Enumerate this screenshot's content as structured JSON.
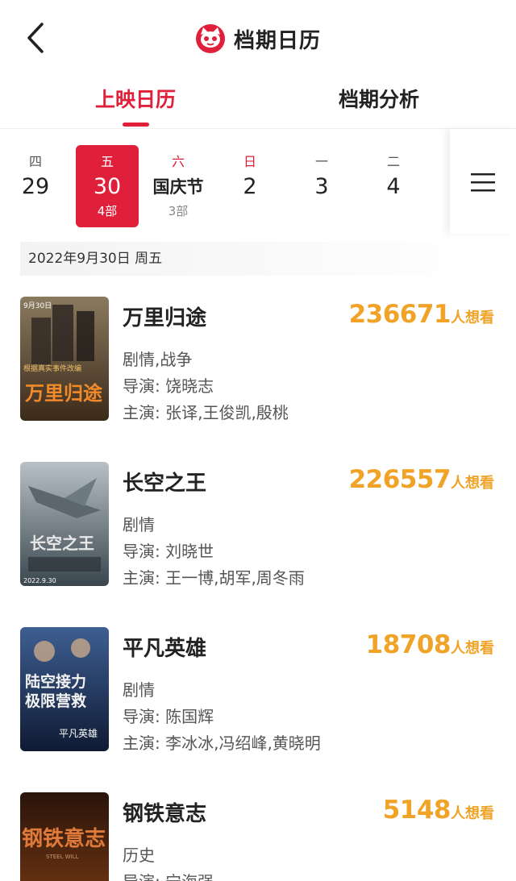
{
  "header": {
    "title": "档期日历"
  },
  "tabs": [
    {
      "label": "上映日历",
      "active": true
    },
    {
      "label": "档期分析",
      "active": false
    }
  ],
  "dates": [
    {
      "weekday": "四",
      "day": "29",
      "count": "",
      "active": false,
      "weekend": false
    },
    {
      "weekday": "五",
      "day": "30",
      "count": "4部",
      "active": true,
      "weekend": false
    },
    {
      "weekday": "六",
      "day": "国庆节",
      "count": "3部",
      "active": false,
      "weekend": true
    },
    {
      "weekday": "日",
      "day": "2",
      "count": "",
      "active": false,
      "weekend": true
    },
    {
      "weekday": "一",
      "day": "3",
      "count": "",
      "active": false,
      "weekend": false
    },
    {
      "weekday": "二",
      "day": "4",
      "count": "",
      "active": false,
      "weekend": false
    }
  ],
  "date_banner": "2022年9月30日  周五",
  "movies": [
    {
      "title": "万里归途",
      "want": "236671",
      "want_label": "人想看",
      "genre": "剧情,战争",
      "director": "导演:  饶晓志",
      "cast": "主演:  张译,王俊凯,殷桃",
      "poster_colors": [
        "#6b5a3e",
        "#b68a4a"
      ]
    },
    {
      "title": "长空之王",
      "want": "226557",
      "want_label": "人想看",
      "genre": "剧情",
      "director": "导演:  刘晓世",
      "cast": "主演:  王一博,胡军,周冬雨",
      "poster_colors": [
        "#7f8a93",
        "#3d4a52"
      ]
    },
    {
      "title": "平凡英雄",
      "want": "18708",
      "want_label": "人想看",
      "genre": "剧情",
      "director": "导演:  陈国辉",
      "cast": "主演:  李冰冰,冯绍峰,黄晓明",
      "poster_colors": [
        "#2f4a7a",
        "#14213d"
      ]
    },
    {
      "title": "钢铁意志",
      "want": "5148",
      "want_label": "人想看",
      "genre": "历史",
      "director": "导演:  宁海强",
      "cast": "",
      "poster_colors": [
        "#3a1f12",
        "#8a4a1e"
      ]
    }
  ],
  "poster_texts": {
    "poster1_date": "9月30日",
    "poster1_big": "万里归途",
    "poster1_small": "根据真实事件改编",
    "poster2_big": "长空之王",
    "poster2_date": "2022.9.30",
    "poster3_line1": "陆空接力",
    "poster3_line2": "极限营救",
    "poster3_sig": "平凡英雄",
    "poster4_big": "钢铁意志",
    "poster4_sub": "STEEL WILL"
  }
}
